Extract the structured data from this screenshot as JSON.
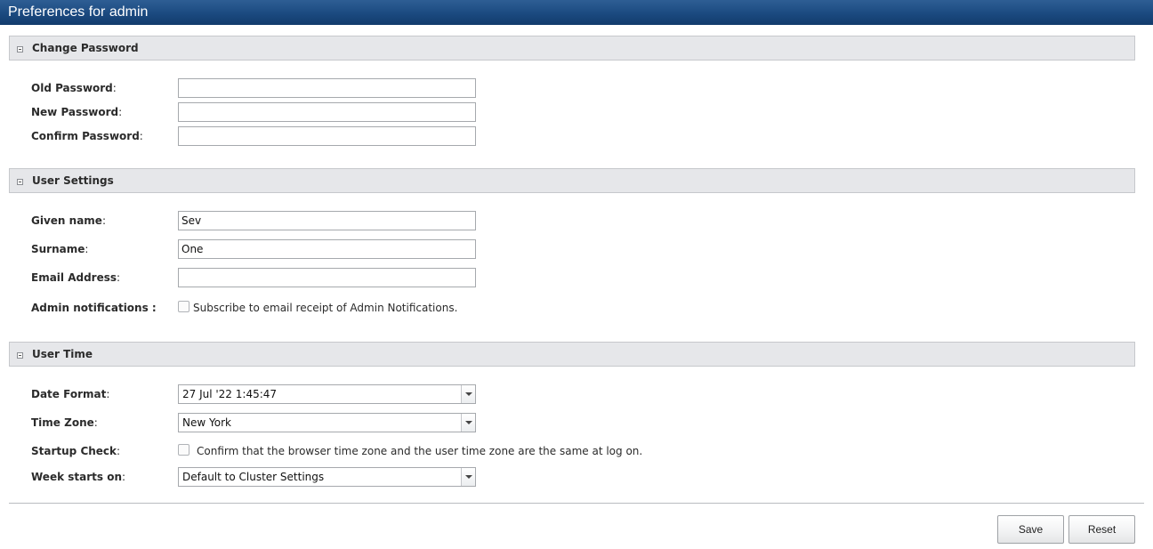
{
  "window": {
    "title": "Preferences for admin"
  },
  "sections": {
    "change_password": {
      "title": "Change Password",
      "toggle_icon": "collapse-minus-icon",
      "old_password_label": "Old Password",
      "new_password_label": "New Password",
      "confirm_password_label": "Confirm Password",
      "old_password_value": "",
      "new_password_value": "",
      "confirm_password_value": ""
    },
    "user_settings": {
      "title": "User Settings",
      "toggle_icon": "collapse-minus-icon",
      "given_name_label": "Given name",
      "given_name_value": "Sev",
      "surname_label": "Surname",
      "surname_value": "One",
      "email_label": "Email Address",
      "email_value": "",
      "admin_notifications_label": "Admin notifications :",
      "admin_notifications_checked": false,
      "admin_notifications_text": "Subscribe to email receipt of Admin Notifications."
    },
    "user_time": {
      "title": "User Time",
      "toggle_icon": "collapse-minus-icon",
      "date_format_label": "Date Format",
      "date_format_value": "27 Jul '22 1:45:47",
      "time_zone_label": "Time Zone",
      "time_zone_value": "New York",
      "startup_check_label": "Startup Check",
      "startup_check_checked": false,
      "startup_check_text": "Confirm that the browser time zone and the user time zone are the same at log on.",
      "week_starts_label": "Week starts on",
      "week_starts_value": "Default to Cluster Settings"
    }
  },
  "footer": {
    "save_label": "Save",
    "reset_label": "Reset"
  },
  "colors": {
    "titlebar": "#1b4a80",
    "section_header_bg": "#e6e7ea"
  }
}
